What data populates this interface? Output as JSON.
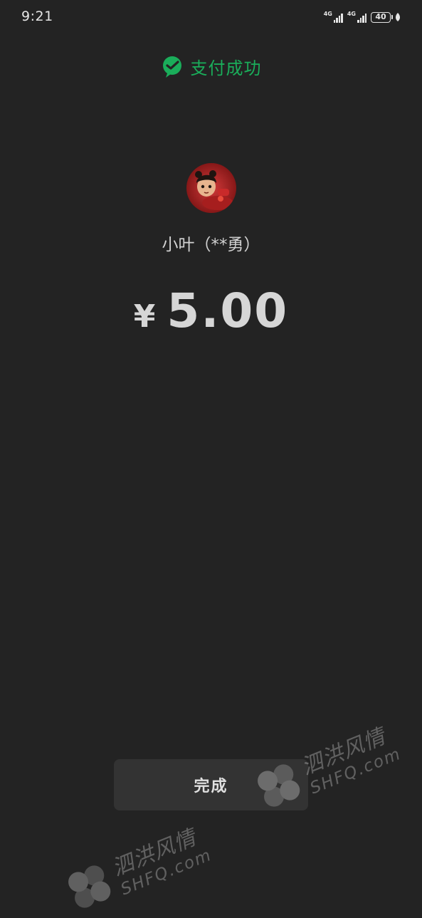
{
  "status_bar": {
    "time": "9:21",
    "network_1": "4G",
    "network_2": "4G",
    "battery": "40"
  },
  "header": {
    "title": "支付成功",
    "icon": "wechat-pay-icon",
    "accent_color": "#1aad5a"
  },
  "payee": {
    "name": "小叶（**勇）",
    "avatar": "avatar"
  },
  "amount": {
    "currency": "¥",
    "value": "5.00"
  },
  "done_button": {
    "label": "完成"
  },
  "watermark": {
    "chinese": "泗洪风情",
    "latin": "SHFQ.com"
  }
}
